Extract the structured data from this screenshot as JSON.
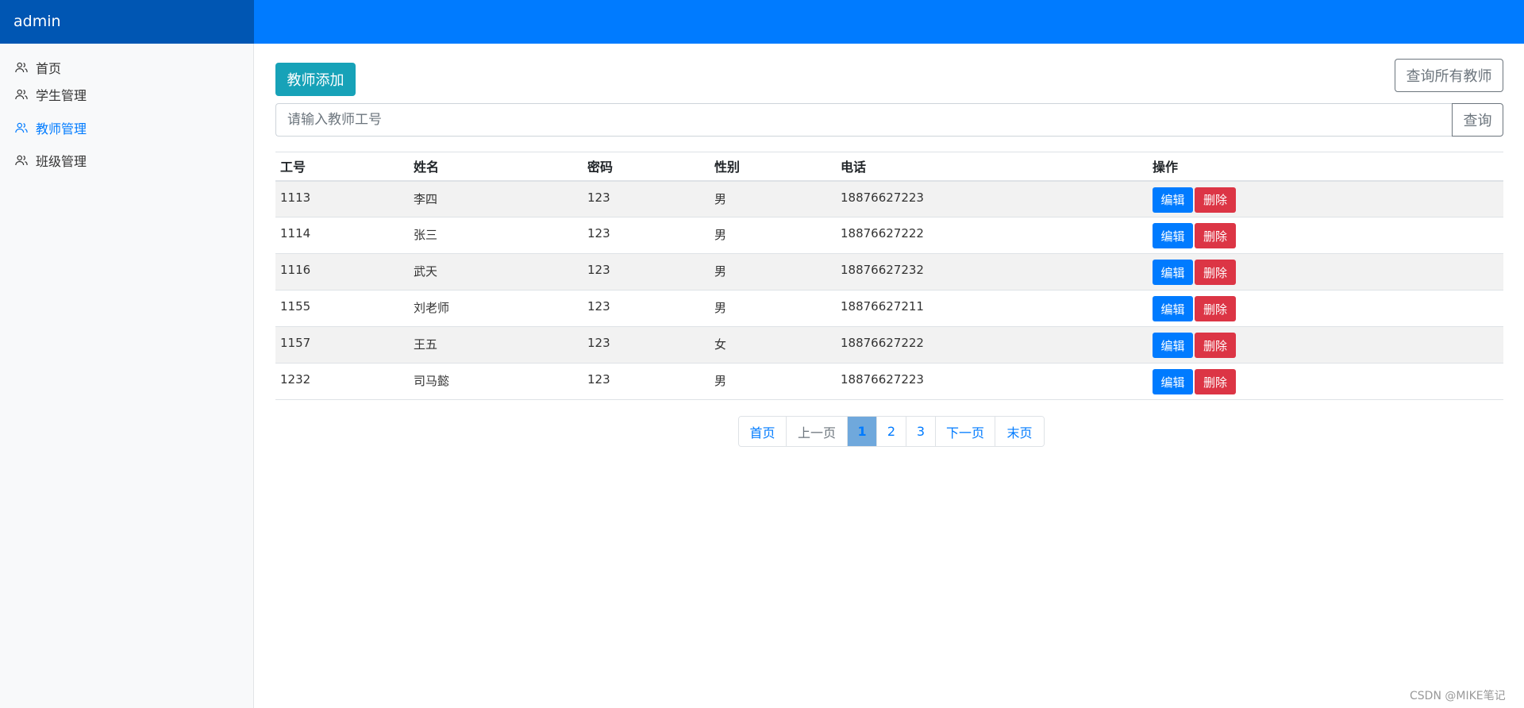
{
  "header": {
    "brand": "admin"
  },
  "sidebar": {
    "items": [
      {
        "label": "首页",
        "icon": "users-icon",
        "active": false
      },
      {
        "label": "学生管理",
        "icon": "users-icon",
        "active": false
      },
      {
        "label": "教师管理",
        "icon": "users-icon",
        "active": true
      },
      {
        "label": "班级管理",
        "icon": "users-icon",
        "active": false
      }
    ]
  },
  "toolbar": {
    "add_label": "教师添加",
    "query_all_label": "查询所有教师",
    "search_placeholder": "请输入教师工号",
    "search_value": "",
    "search_label": "查询"
  },
  "table": {
    "headers": [
      "工号",
      "姓名",
      "密码",
      "性别",
      "电话",
      "操作"
    ],
    "edit_label": "编辑",
    "delete_label": "删除",
    "rows": [
      [
        "1113",
        "李四",
        "123",
        "男",
        "18876627223"
      ],
      [
        "1114",
        "张三",
        "123",
        "男",
        "18876627222"
      ],
      [
        "1116",
        "武天",
        "123",
        "男",
        "18876627232"
      ],
      [
        "1155",
        "刘老师",
        "123",
        "男",
        "18876627211"
      ],
      [
        "1157",
        "王五",
        "123",
        "女",
        "18876627222"
      ],
      [
        "1232",
        "司马懿",
        "123",
        "男",
        "18876627223"
      ]
    ]
  },
  "pagination": {
    "first": "首页",
    "prev": "上一页",
    "pages": [
      "1",
      "2",
      "3"
    ],
    "current": "1",
    "next": "下一页",
    "last": "末页"
  },
  "watermark": "CSDN @MIKE笔记",
  "colors": {
    "primary": "#007bff",
    "brand_bg": "#0056b3",
    "info": "#17a2b8",
    "danger": "#dc3545",
    "secondary": "#6c757d",
    "active_page": "#6fa8dc"
  }
}
